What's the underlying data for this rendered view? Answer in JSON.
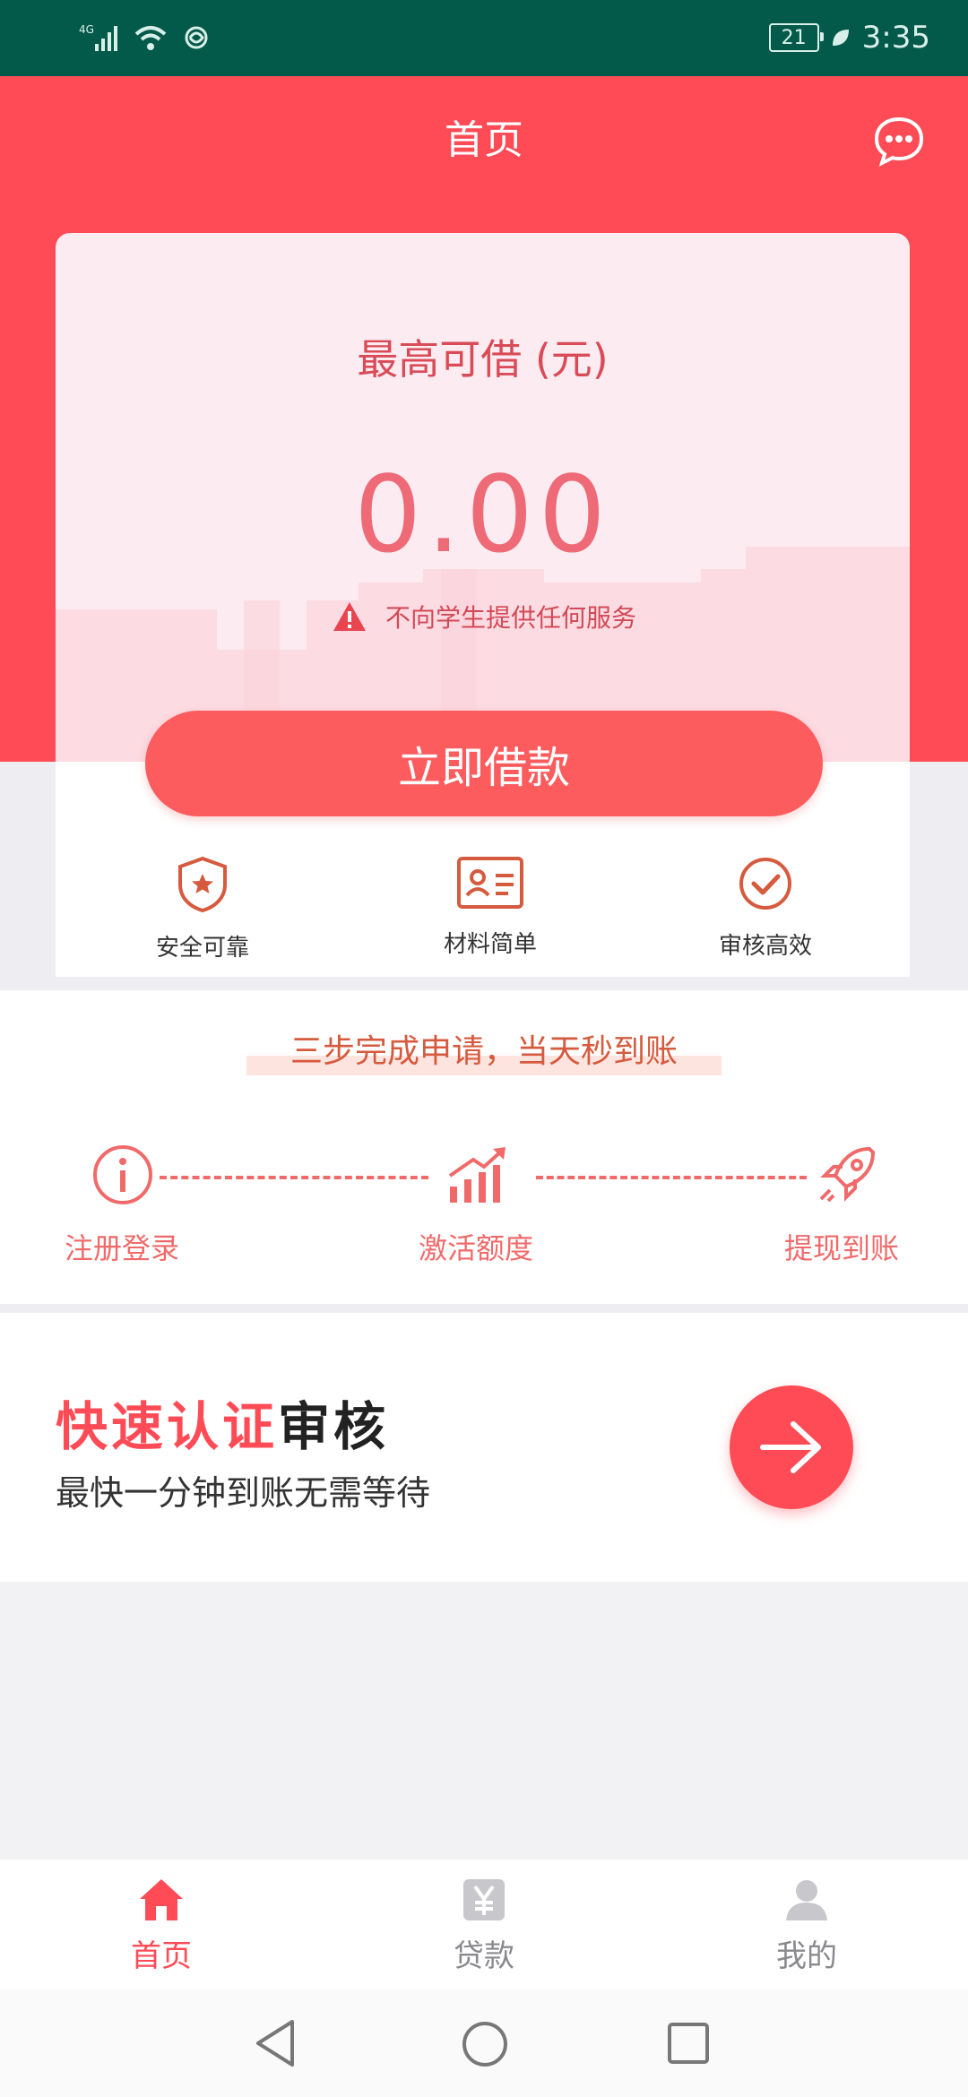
{
  "status_bar": {
    "network": "4G",
    "battery": "21",
    "time": "3:35"
  },
  "header": {
    "title": "首页",
    "icon": "message-icon"
  },
  "loan_card": {
    "label": "最高可借 (元)",
    "amount": "0.00",
    "notice": "不向学生提供任何服务",
    "button": "立即借款",
    "features": [
      {
        "label": "安全可靠",
        "icon": "shield-star-icon"
      },
      {
        "label": "材料简单",
        "icon": "id-card-icon"
      },
      {
        "label": "审核高效",
        "icon": "check-circle-icon"
      }
    ]
  },
  "steps": {
    "slogan": "三步完成申请，当天秒到账",
    "items": [
      {
        "label": "注册登录",
        "icon": "info-icon"
      },
      {
        "label": "激活额度",
        "icon": "chart-up-icon"
      },
      {
        "label": "提现到账",
        "icon": "rocket-icon"
      }
    ]
  },
  "quick_auth": {
    "title_highlight": "快速认证",
    "title_rest": "审核",
    "subtitle": "最快一分钟到账无需等待"
  },
  "tab_bar": {
    "items": [
      {
        "label": "首页",
        "icon": "home-icon",
        "active": true
      },
      {
        "label": "贷款",
        "icon": "yen-icon",
        "active": false
      },
      {
        "label": "我的",
        "icon": "user-icon",
        "active": false
      }
    ]
  },
  "colors": {
    "primary": "#ff4b55",
    "status_bar": "#035a4a",
    "step_red": "#f06a6a"
  }
}
